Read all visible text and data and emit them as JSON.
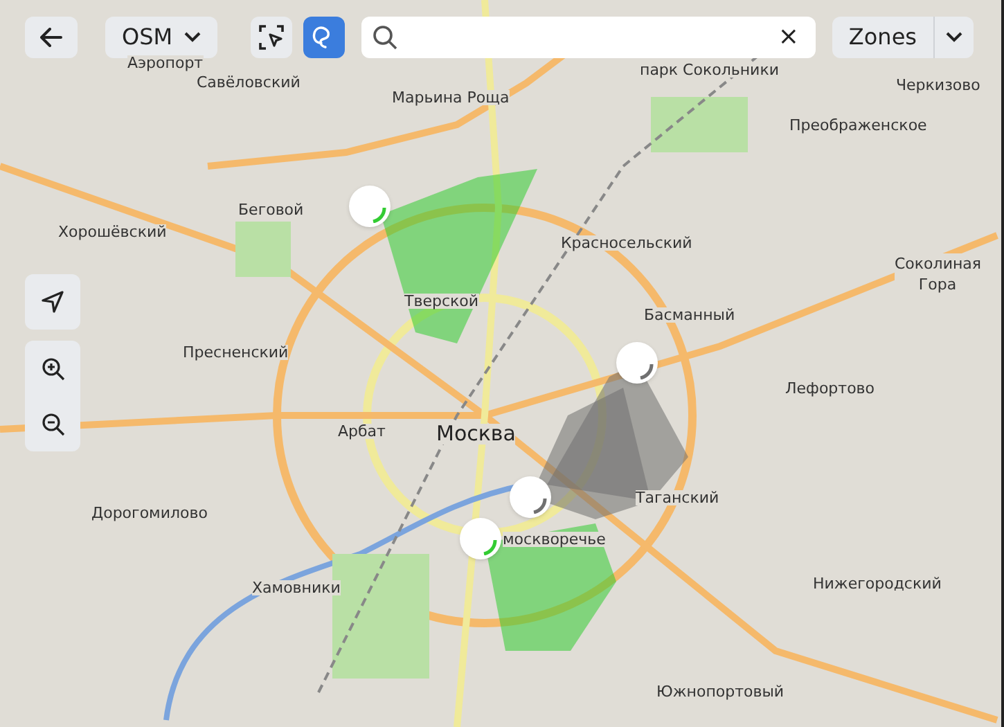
{
  "toolbar": {
    "layer_select": {
      "label": "OSM"
    },
    "draw_tool": {
      "selected": true
    },
    "search": {
      "clear": "×"
    },
    "zones_select": {
      "label": "Zones"
    }
  },
  "map_labels": [
    "Аэропорт",
    "Савёловский",
    "Марьина Роща",
    "парк Сокольники",
    "Черкизово",
    "Преображенское",
    "Беговой",
    "Хорошёвский",
    "Красносельский",
    "Соколиная Гора",
    "Тверской",
    "Басманный",
    "Пресненский",
    "Лефортово",
    "Арбат",
    "Москва",
    "Таганский",
    "Дорогомилово",
    "москворечье",
    "Хамовники",
    "Нижегородский",
    "Южнопортовый"
  ],
  "sectors": [
    {
      "color": "#33cc33"
    },
    {
      "color": "#707070"
    },
    {
      "color": "#707070"
    },
    {
      "color": "#33cc33"
    }
  ]
}
